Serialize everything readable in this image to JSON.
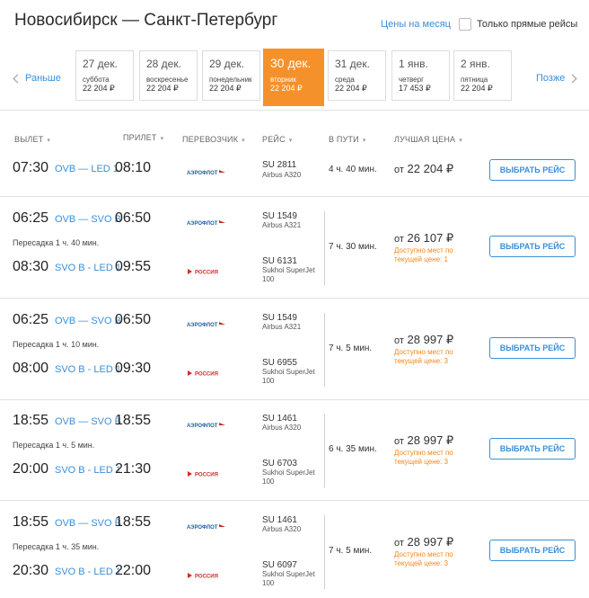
{
  "header": {
    "title": "Новосибирск — Санкт-Петербург",
    "month_prices_link": "Цены на месяц",
    "direct_only_label": "Только прямые рейсы",
    "direct_only_checked": false
  },
  "date_nav": {
    "earlier": "Раньше",
    "later": "Позже",
    "dates": [
      {
        "date": "27 дек.",
        "weekday": "суббота",
        "price": "22 204 ₽",
        "active": false
      },
      {
        "date": "28 дек.",
        "weekday": "воскресенье",
        "price": "22 204 ₽",
        "active": false
      },
      {
        "date": "29 дек.",
        "weekday": "понедельник",
        "price": "22 204 ₽",
        "active": false
      },
      {
        "date": "30 дек.",
        "weekday": "вторник",
        "price": "22 204 ₽",
        "active": true
      },
      {
        "date": "31 дек.",
        "weekday": "среда",
        "price": "22 204 ₽",
        "active": false
      },
      {
        "date": "1 янв.",
        "weekday": "четверг",
        "price": "17 453 ₽",
        "active": false
      },
      {
        "date": "2 янв.",
        "weekday": "пятница",
        "price": "22 204 ₽",
        "active": false
      }
    ]
  },
  "columns": {
    "departure": "ВЫЛЕТ",
    "arrival": "ПРИЛЕТ",
    "carrier": "ПЕРЕВОЗЧИК",
    "flight": "РЕЙС",
    "duration": "В ПУТИ",
    "best_price": "ЛУЧШАЯ ЦЕНА",
    "sort_caret": "▾"
  },
  "colors": {
    "accent_orange": "#f5912b",
    "link_blue": "#3a8fd8",
    "seats_orange": "#f0881d"
  },
  "logos": {
    "aeroflot": "АЭРОФЛОТ",
    "rossiya": "РОССИЯ"
  },
  "select_label": "ВЫБРАТЬ РЕЙС",
  "flights": [
    {
      "dep_time": "07:30",
      "route": "OVB — LED 1",
      "arr_time": "08:10",
      "carrier": "aeroflot",
      "flight_no": "SU 2811",
      "aircraft": "Airbus A320",
      "duration": "4 ч. 40 мин.",
      "price_prefix": "от",
      "price": "22 204 ₽",
      "seats": ""
    },
    {
      "leg1": {
        "dep_time": "06:25",
        "route": "OVB — SVO B",
        "arr_time": "06:50",
        "carrier": "aeroflot",
        "flight_no": "SU 1549",
        "aircraft": "Airbus A321"
      },
      "transfer": "Пересадка 1 ч. 40 мин.",
      "leg2": {
        "dep_time": "08:30",
        "route": "SVO B - LED 1",
        "arr_time": "09:55",
        "carrier": "rossiya",
        "flight_no": "SU 6131",
        "aircraft": "Sukhoi SuperJet 100"
      },
      "duration": "7 ч. 30 мин.",
      "price_prefix": "от",
      "price": "26 107 ₽",
      "seats": "Доступно мест по текущей цене: 1"
    },
    {
      "leg1": {
        "dep_time": "06:25",
        "route": "OVB — SVO B",
        "arr_time": "06:50",
        "carrier": "aeroflot",
        "flight_no": "SU 1549",
        "aircraft": "Airbus A321"
      },
      "transfer": "Пересадка 1 ч. 10 мин.",
      "leg2": {
        "dep_time": "08:00",
        "route": "SVO B - LED 1",
        "arr_time": "09:30",
        "carrier": "rossiya",
        "flight_no": "SU 6955",
        "aircraft": "Sukhoi SuperJet 100"
      },
      "duration": "7 ч. 5 мин.",
      "price_prefix": "от",
      "price": "28 997 ₽",
      "seats": "Доступно мест по текущей цене: 3"
    },
    {
      "leg1": {
        "dep_time": "18:55",
        "route": "OVB — SVO B",
        "arr_time": "18:55",
        "carrier": "aeroflot",
        "flight_no": "SU 1461",
        "aircraft": "Airbus A320"
      },
      "transfer": "Пересадка 1 ч. 5 мин.",
      "leg2": {
        "dep_time": "20:00",
        "route": "SVO B - LED 1",
        "arr_time": "21:30",
        "carrier": "rossiya",
        "flight_no": "SU 6703",
        "aircraft": "Sukhoi SuperJet 100"
      },
      "duration": "6 ч. 35 мин.",
      "price_prefix": "от",
      "price": "28 997 ₽",
      "seats": "Доступно мест по текущей цене: 3"
    },
    {
      "leg1": {
        "dep_time": "18:55",
        "route": "OVB — SVO B",
        "arr_time": "18:55",
        "carrier": "aeroflot",
        "flight_no": "SU 1461",
        "aircraft": "Airbus A320"
      },
      "transfer": "Пересадка 1 ч. 35 мин.",
      "leg2": {
        "dep_time": "20:30",
        "route": "SVO B - LED 1",
        "arr_time": "22:00",
        "carrier": "rossiya",
        "flight_no": "SU 6097",
        "aircraft": "Sukhoi SuperJet 100"
      },
      "duration": "7 ч. 5 мин.",
      "price_prefix": "от",
      "price": "28 997 ₽",
      "seats": "Доступно мест по текущей цене: 3"
    }
  ]
}
